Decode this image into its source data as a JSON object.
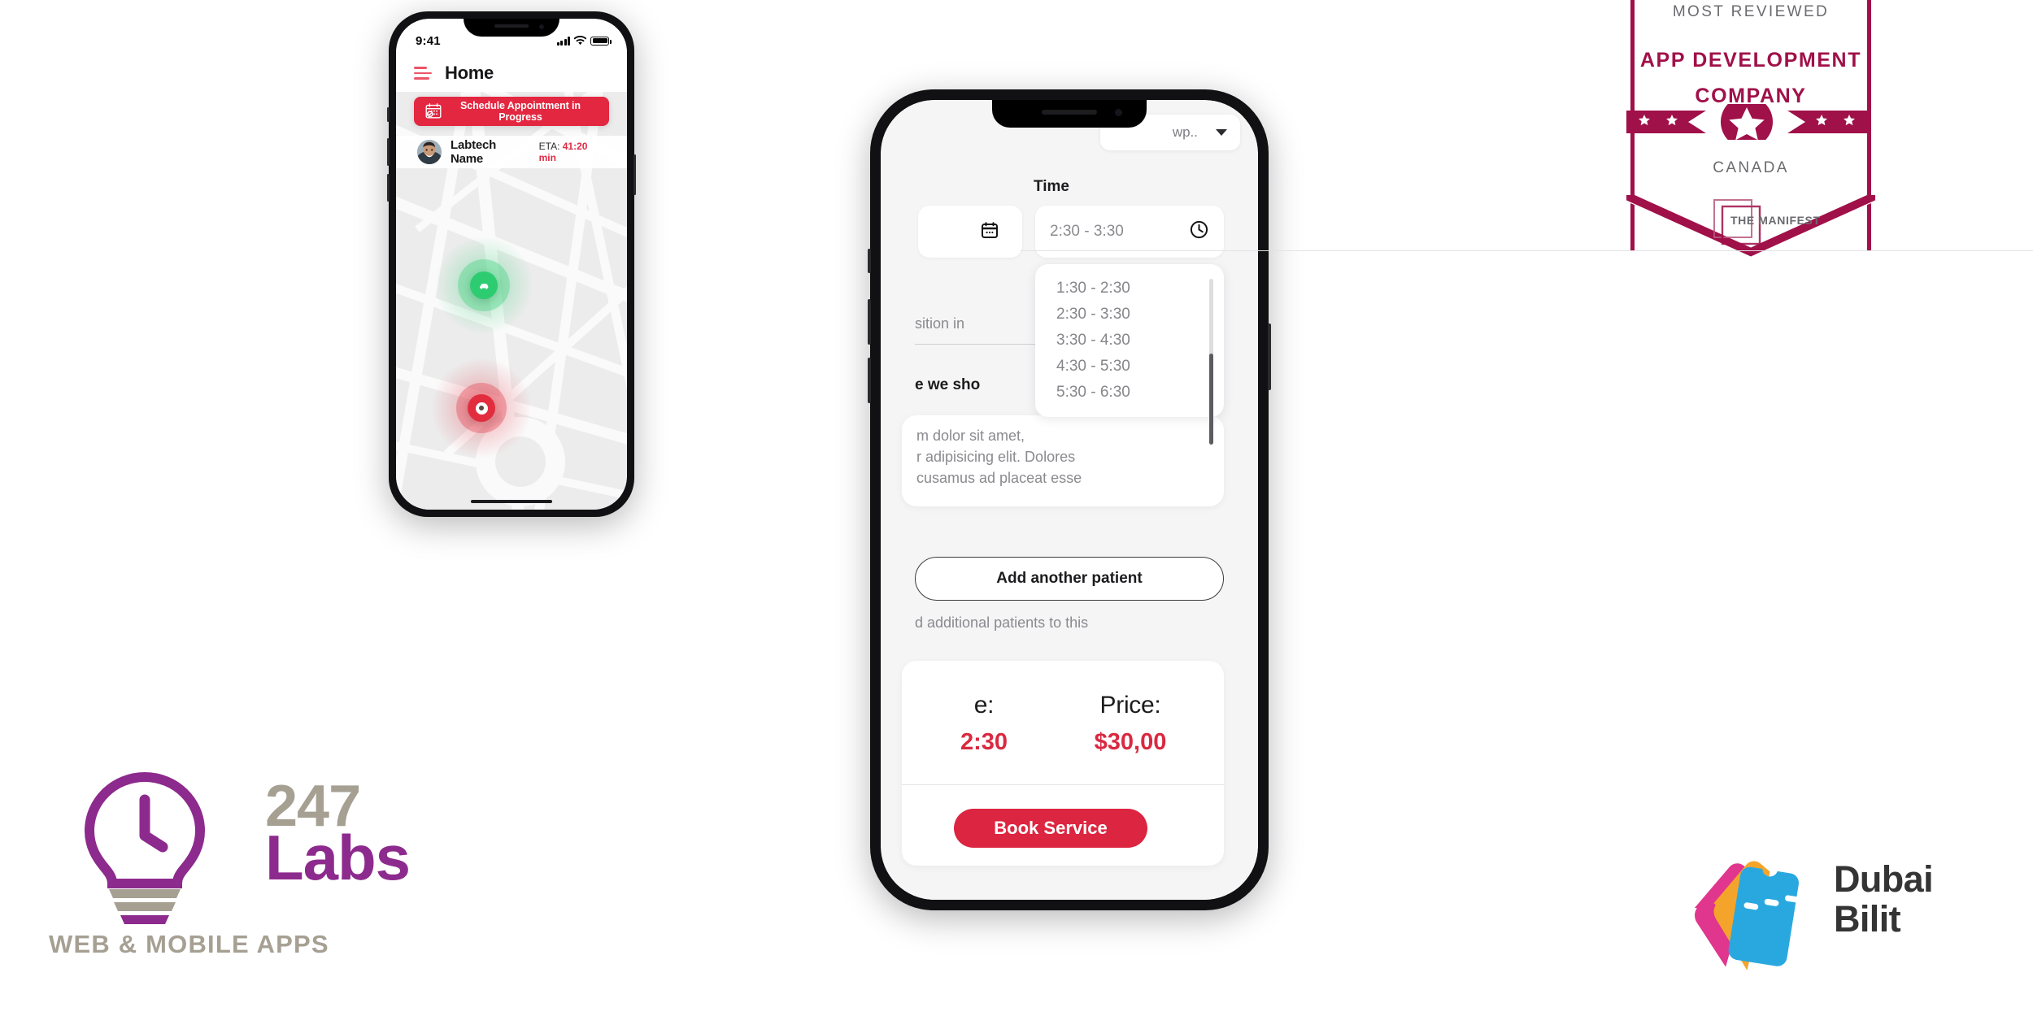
{
  "brand": {
    "primary_red": "#dc2540",
    "accent_pink": "#ec5467",
    "manifest_maroon": "#a01049",
    "labs_purple": "#8d2a8d",
    "labs_grey": "#a6a093",
    "marker_green": "#2ecc71"
  },
  "front_phone": {
    "status_bar": {
      "time": "9:41",
      "signal_icon": "cellular-bars-icon",
      "wifi_icon": "wifi-icon",
      "battery_icon": "battery-full-icon"
    },
    "header": {
      "menu_icon": "hamburger-menu-icon",
      "title": "Home"
    },
    "schedule_banner": {
      "icon": "calendar-check-icon",
      "label": "Schedule Appointment in Progress"
    },
    "labtech": {
      "avatar_icon": "labtech-avatar",
      "name": "Labtech Name",
      "eta_label": "ETA:",
      "eta_value": "41:20 min"
    },
    "map": {
      "driver_marker_icon": "car-marker-icon",
      "destination_marker_icon": "destination-pin-icon"
    },
    "home_indicator": "home-indicator"
  },
  "back_phone": {
    "top_select": {
      "value": "wp..",
      "chevron_icon": "chevron-down-icon"
    },
    "time_section": {
      "label": "Time",
      "selected_value": "2:30 - 3:30",
      "clock_icon": "clock-icon",
      "calendar_icon": "calendar-icon",
      "options": [
        "1:30 - 2:30",
        "2:30 - 3:30",
        "3:30 - 4:30",
        "4:30 - 5:30",
        "5:30 - 6:30"
      ]
    },
    "position_field_text": "sition in",
    "question_text": "e we sho",
    "description": "m dolor sit amet,\nr adipisicing elit. Dolores\ncusamus ad placeat esse",
    "add_patient": {
      "label": "Add another patient",
      "helper": "d additional patients to this"
    },
    "summary": {
      "time_title": "e:",
      "time_value": "2:30",
      "price_title": "Price:",
      "price_value": "$30,00"
    },
    "book_button": "Book Service"
  },
  "logo_247labs": {
    "number": "247",
    "word": "Labs",
    "tagline": "WEB & MOBILE APPS",
    "icon": "lightbulb-clock-icon"
  },
  "badge_manifest": {
    "line1": "MOST REVIEWED",
    "line2": "APP DEVELOPMENT",
    "line3": "COMPANY",
    "line4": "CANADA",
    "logo_text": "THE MANIFEST",
    "star_icon": "star-icon"
  },
  "logo_dubai": {
    "line1": "Dubai",
    "line2": "Bilit",
    "icon": "ticket-cards-icon"
  }
}
